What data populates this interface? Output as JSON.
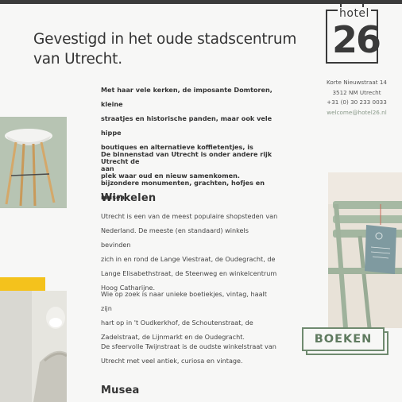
{
  "header": {
    "headline_line1": "Gevestigd in het oude stadscentrum",
    "headline_line2": "van Utrecht."
  },
  "logo": {
    "word": "hotel",
    "number": "26"
  },
  "contact": {
    "street": "Korte Nieuwstraat 14",
    "postal": "3512 NM Utrecht",
    "phone": "+31 (0) 30 233 0033",
    "email": "welcome@hotel26.nl"
  },
  "intro": {
    "p1_lines": [
      "Met haar vele kerken, de imposante Domtoren, kleine",
      "straatjes en historische panden, maar ook vele hippe",
      "boutiques en alternatieve koffietentjes, is Utrecht de",
      "plek waar oud en nieuw samenkomen."
    ],
    "p2_lines": [
      "De binnenstad van Utrecht is onder andere rijk aan",
      "bijzondere monumenten, grachten, hofjes en musea."
    ]
  },
  "winkelen": {
    "title": "Winkelen",
    "p1_lines": [
      "Utrecht is een van de meest populaire shopsteden van",
      "Nederland. De meeste (en standaard) winkels bevinden",
      "zich in en rond de Lange Viestraat, de Oudegracht, de",
      "Lange Elisabethstraat, de Steenweg en winkelcentrum",
      "Hoog Catharijne."
    ],
    "p2_lines": [
      "Wie op zoek is naar unieke boetiekjes, vintag, haalt zijn",
      "hart op in 't Oudkerkhof, de Schoutenstraat, de",
      "Zadelstraat, de Lijnmarkt en de Oudegracht."
    ],
    "p3_lines": [
      "De sfeervolle Twijnstraat is de oudste winkelstraat van",
      "Utrecht met veel antiek, curiosa en vintage."
    ]
  },
  "musea": {
    "title": "Musea"
  },
  "booking": {
    "label": "BOEKEN"
  },
  "colors": {
    "accent_green": "#6f8a6f",
    "yellow": "#f4c21c",
    "sage": "#b7c4b3",
    "dark": "#3b3b3b"
  }
}
